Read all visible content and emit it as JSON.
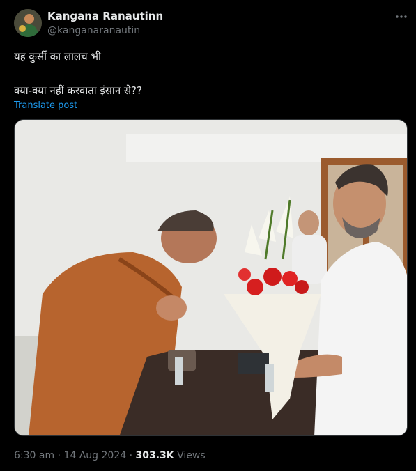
{
  "author": {
    "display_name": "Kangana Ranautinn",
    "handle": "@kanganaranautin"
  },
  "icons": {
    "more": "more-horizontal-icon"
  },
  "post": {
    "line1": "यह कुर्सी का लालच भी",
    "line2": "क्या-क्या नहीं करवाता इंसान से??",
    "translate_link": "Translate post"
  },
  "meta": {
    "time": "6:30 am",
    "separator1": " · ",
    "date": "14 Aug 2024",
    "separator2": " · ",
    "views_count": "303.3K",
    "views_label": " Views"
  },
  "colors": {
    "background": "#000000",
    "link": "#1d9bf0",
    "secondary": "#71767b",
    "text": "#e7e9ea"
  }
}
